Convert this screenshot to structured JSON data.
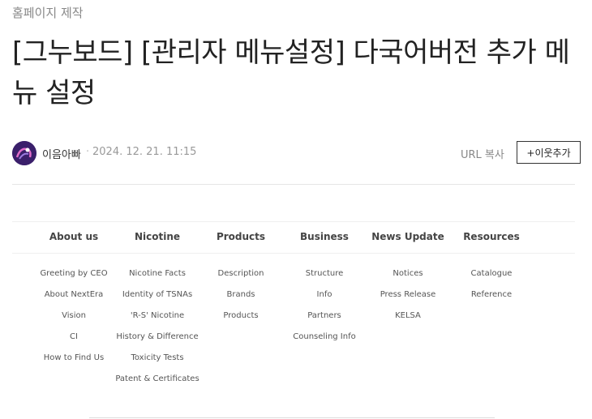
{
  "post": {
    "category": "홈페이지 제작",
    "title": "[그누보드] [관리자 메뉴설정] 다국어버전 추가 메뉴 설정",
    "author": "이음아빠",
    "separator": "·",
    "date": "2024. 12. 21. 11:15",
    "url_copy": "URL 복사",
    "add_neighbor": "+이웃추가"
  },
  "footer": {
    "columns": [
      {
        "head": "About us",
        "items": [
          "Greeting by CEO",
          "About NextEra",
          "Vision",
          "CI",
          "How to Find Us"
        ]
      },
      {
        "head": "Nicotine",
        "items": [
          "Nicotine Facts",
          "Identity of TSNAs",
          "'R-S' Nicotine",
          "History & Difference",
          "Toxicity Tests",
          "Patent & Certificates"
        ]
      },
      {
        "head": "Products",
        "items": [
          "Description",
          "Brands",
          "Products"
        ]
      },
      {
        "head": "Business",
        "items": [
          "Structure",
          "Info",
          "Partners",
          "Counseling Info"
        ]
      },
      {
        "head": "News Update",
        "items": [
          "Notices",
          "Press Release",
          "KELSA"
        ]
      },
      {
        "head": "Resources",
        "items": [
          "Catalogue",
          "Reference"
        ]
      }
    ]
  }
}
